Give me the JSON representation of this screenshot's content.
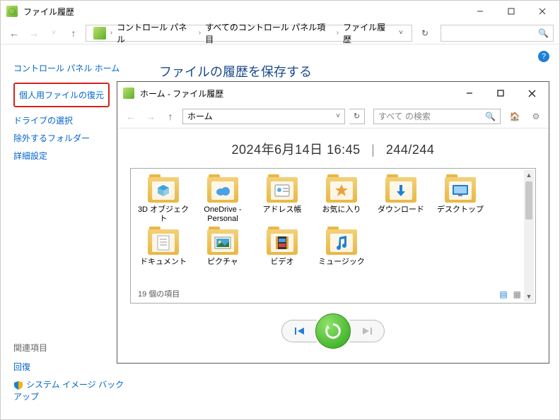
{
  "outer": {
    "title": "ファイル履歴",
    "breadcrumb": [
      "コントロール パネル",
      "すべてのコントロール パネル項目",
      "ファイル履歴"
    ]
  },
  "leftnav": {
    "home": "コントロール パネル ホーム",
    "restore": "個人用ファイルの復元",
    "drive": "ドライブの選択",
    "exclude": "除外するフォルダー",
    "advanced": "詳細設定",
    "related_hdr": "関連項目",
    "recovery": "回復",
    "backup": "システム イメージ バックアップ"
  },
  "main_heading": "ファイルの履歴を保存する",
  "inner": {
    "title": "ホーム - ファイル履歴",
    "address": "ホーム",
    "search_placeholder": "すべて の検索",
    "timestamp_date": "2024年6月14日 16:45",
    "timestamp_count": "244/244",
    "status": "19 個の項目",
    "folders": [
      {
        "label": "3D オブジェクト",
        "badge": "color:#36a4e0;type:cube"
      },
      {
        "label": "OneDrive - Personal",
        "badge": "type:cloud"
      },
      {
        "label": "アドレス帳",
        "badge": "type:contact"
      },
      {
        "label": "お気に入り",
        "badge": "color:#e9a23b;type:star"
      },
      {
        "label": "ダウンロード",
        "badge": "color:#1e7fd6;type:download"
      },
      {
        "label": "デスクトップ",
        "badge": "color:#1e7fd6;type:desktop"
      },
      {
        "label": "ドキュメント",
        "badge": "type:doc"
      },
      {
        "label": "ピクチャ",
        "badge": "type:picture"
      },
      {
        "label": "ビデオ",
        "badge": "type:video"
      },
      {
        "label": "ミュージック",
        "badge": "color:#1e7fd6;type:music"
      }
    ]
  }
}
